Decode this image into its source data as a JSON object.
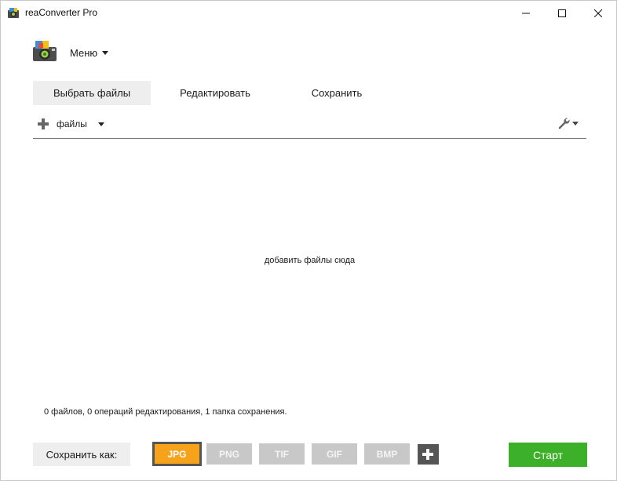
{
  "window": {
    "title": "reaConverter Pro"
  },
  "menu": {
    "label": "Меню"
  },
  "tabs": [
    {
      "label": "Выбрать файлы",
      "active": true
    },
    {
      "label": "Редактировать",
      "active": false
    },
    {
      "label": "Сохранить",
      "active": false
    }
  ],
  "files_toolbar": {
    "add_label": "файлы",
    "icons": {
      "add": "plus-icon",
      "settings": "wrench-icon"
    }
  },
  "drop_zone": {
    "hint": "добавить файлы сюда"
  },
  "status": {
    "summary": "0 файлов, 0 операций редактирования, 1 папка сохранения."
  },
  "bottom_bar": {
    "save_as_label": "Сохранить как:",
    "formats": [
      "JPG",
      "PNG",
      "TIF",
      "GIF",
      "BMP"
    ],
    "selected_format": "JPG",
    "start_label": "Старт"
  },
  "colors": {
    "accent_start": "#3cb028",
    "selected_format": "#f7a21b",
    "inactive_format": "#c8c8c8"
  }
}
